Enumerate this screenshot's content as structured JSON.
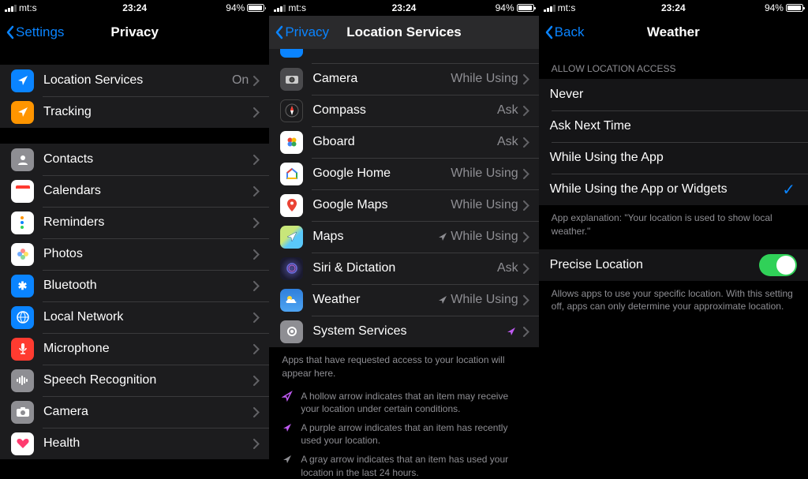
{
  "status": {
    "carrier": "mt:s",
    "time": "23:24",
    "battery": "94%"
  },
  "phone1": {
    "back": "Settings",
    "title": "Privacy",
    "section1": [
      {
        "label": "Location Services",
        "detail": "On",
        "icon": "location",
        "bg": "#0a84ff"
      },
      {
        "label": "Tracking",
        "icon": "tracking",
        "bg": "#ff9500"
      }
    ],
    "section2": [
      {
        "label": "Contacts",
        "icon": "contacts",
        "bg": "#8e8e93"
      },
      {
        "label": "Calendars",
        "icon": "calendar",
        "bg": "#fff"
      },
      {
        "label": "Reminders",
        "icon": "reminders",
        "bg": "#fff"
      },
      {
        "label": "Photos",
        "icon": "photos",
        "bg": "#fff"
      },
      {
        "label": "Bluetooth",
        "icon": "bluetooth",
        "bg": "#0a84ff"
      },
      {
        "label": "Local Network",
        "icon": "network",
        "bg": "#0a84ff"
      },
      {
        "label": "Microphone",
        "icon": "mic",
        "bg": "#ff3b30"
      },
      {
        "label": "Speech Recognition",
        "icon": "speech",
        "bg": "#8e8e93"
      },
      {
        "label": "Camera",
        "icon": "camera",
        "bg": "#8e8e93"
      },
      {
        "label": "Health",
        "icon": "health",
        "bg": "#fff"
      }
    ]
  },
  "phone2": {
    "back": "Privacy",
    "title": "Location Services",
    "apps": [
      {
        "label": "Camera",
        "detail": "While Using",
        "bg": "#555"
      },
      {
        "label": "Compass",
        "detail": "Ask",
        "bg": "#1c1c1e"
      },
      {
        "label": "Gboard",
        "detail": "Ask",
        "bg": "#fff"
      },
      {
        "label": "Google Home",
        "detail": "While Using",
        "bg": "#fff"
      },
      {
        "label": "Google Maps",
        "detail": "While Using",
        "bg": "#fff"
      },
      {
        "label": "Maps",
        "detail": "While Using",
        "arrow": "#8e8e93",
        "bg": "linear-gradient(135deg,#7ed957,#5dc9e8)"
      },
      {
        "label": "Siri & Dictation",
        "detail": "Ask",
        "bg": "radial-gradient(circle,#3a3a7a,#111)"
      },
      {
        "label": "Weather",
        "detail": "While Using",
        "arrow": "#8e8e93",
        "bg": "#0a84ff"
      },
      {
        "label": "System Services",
        "detail": "",
        "arrow": "#bf5af2",
        "bg": "#8e8e93"
      }
    ],
    "footer": "Apps that have requested access to your location will appear here.",
    "legend": [
      {
        "text": "A hollow arrow indicates that an item may receive your location under certain conditions.",
        "style": "hollow"
      },
      {
        "text": "A purple arrow indicates that an item has recently used your location.",
        "style": "purple"
      },
      {
        "text": "A gray arrow indicates that an item has used your location in the last 24 hours.",
        "style": "gray"
      }
    ]
  },
  "phone3": {
    "back": "Back",
    "title": "Weather",
    "sectionHeader": "ALLOW LOCATION ACCESS",
    "options": [
      {
        "label": "Never",
        "checked": false
      },
      {
        "label": "Ask Next Time",
        "checked": false
      },
      {
        "label": "While Using the App",
        "checked": false
      },
      {
        "label": "While Using the App or Widgets",
        "checked": true
      }
    ],
    "explanation": "App explanation: \"Your location is used to show local weather.\"",
    "precise": {
      "label": "Precise Location"
    },
    "preciseFooter": "Allows apps to use your specific location. With this setting off, apps can only determine your approximate location."
  }
}
